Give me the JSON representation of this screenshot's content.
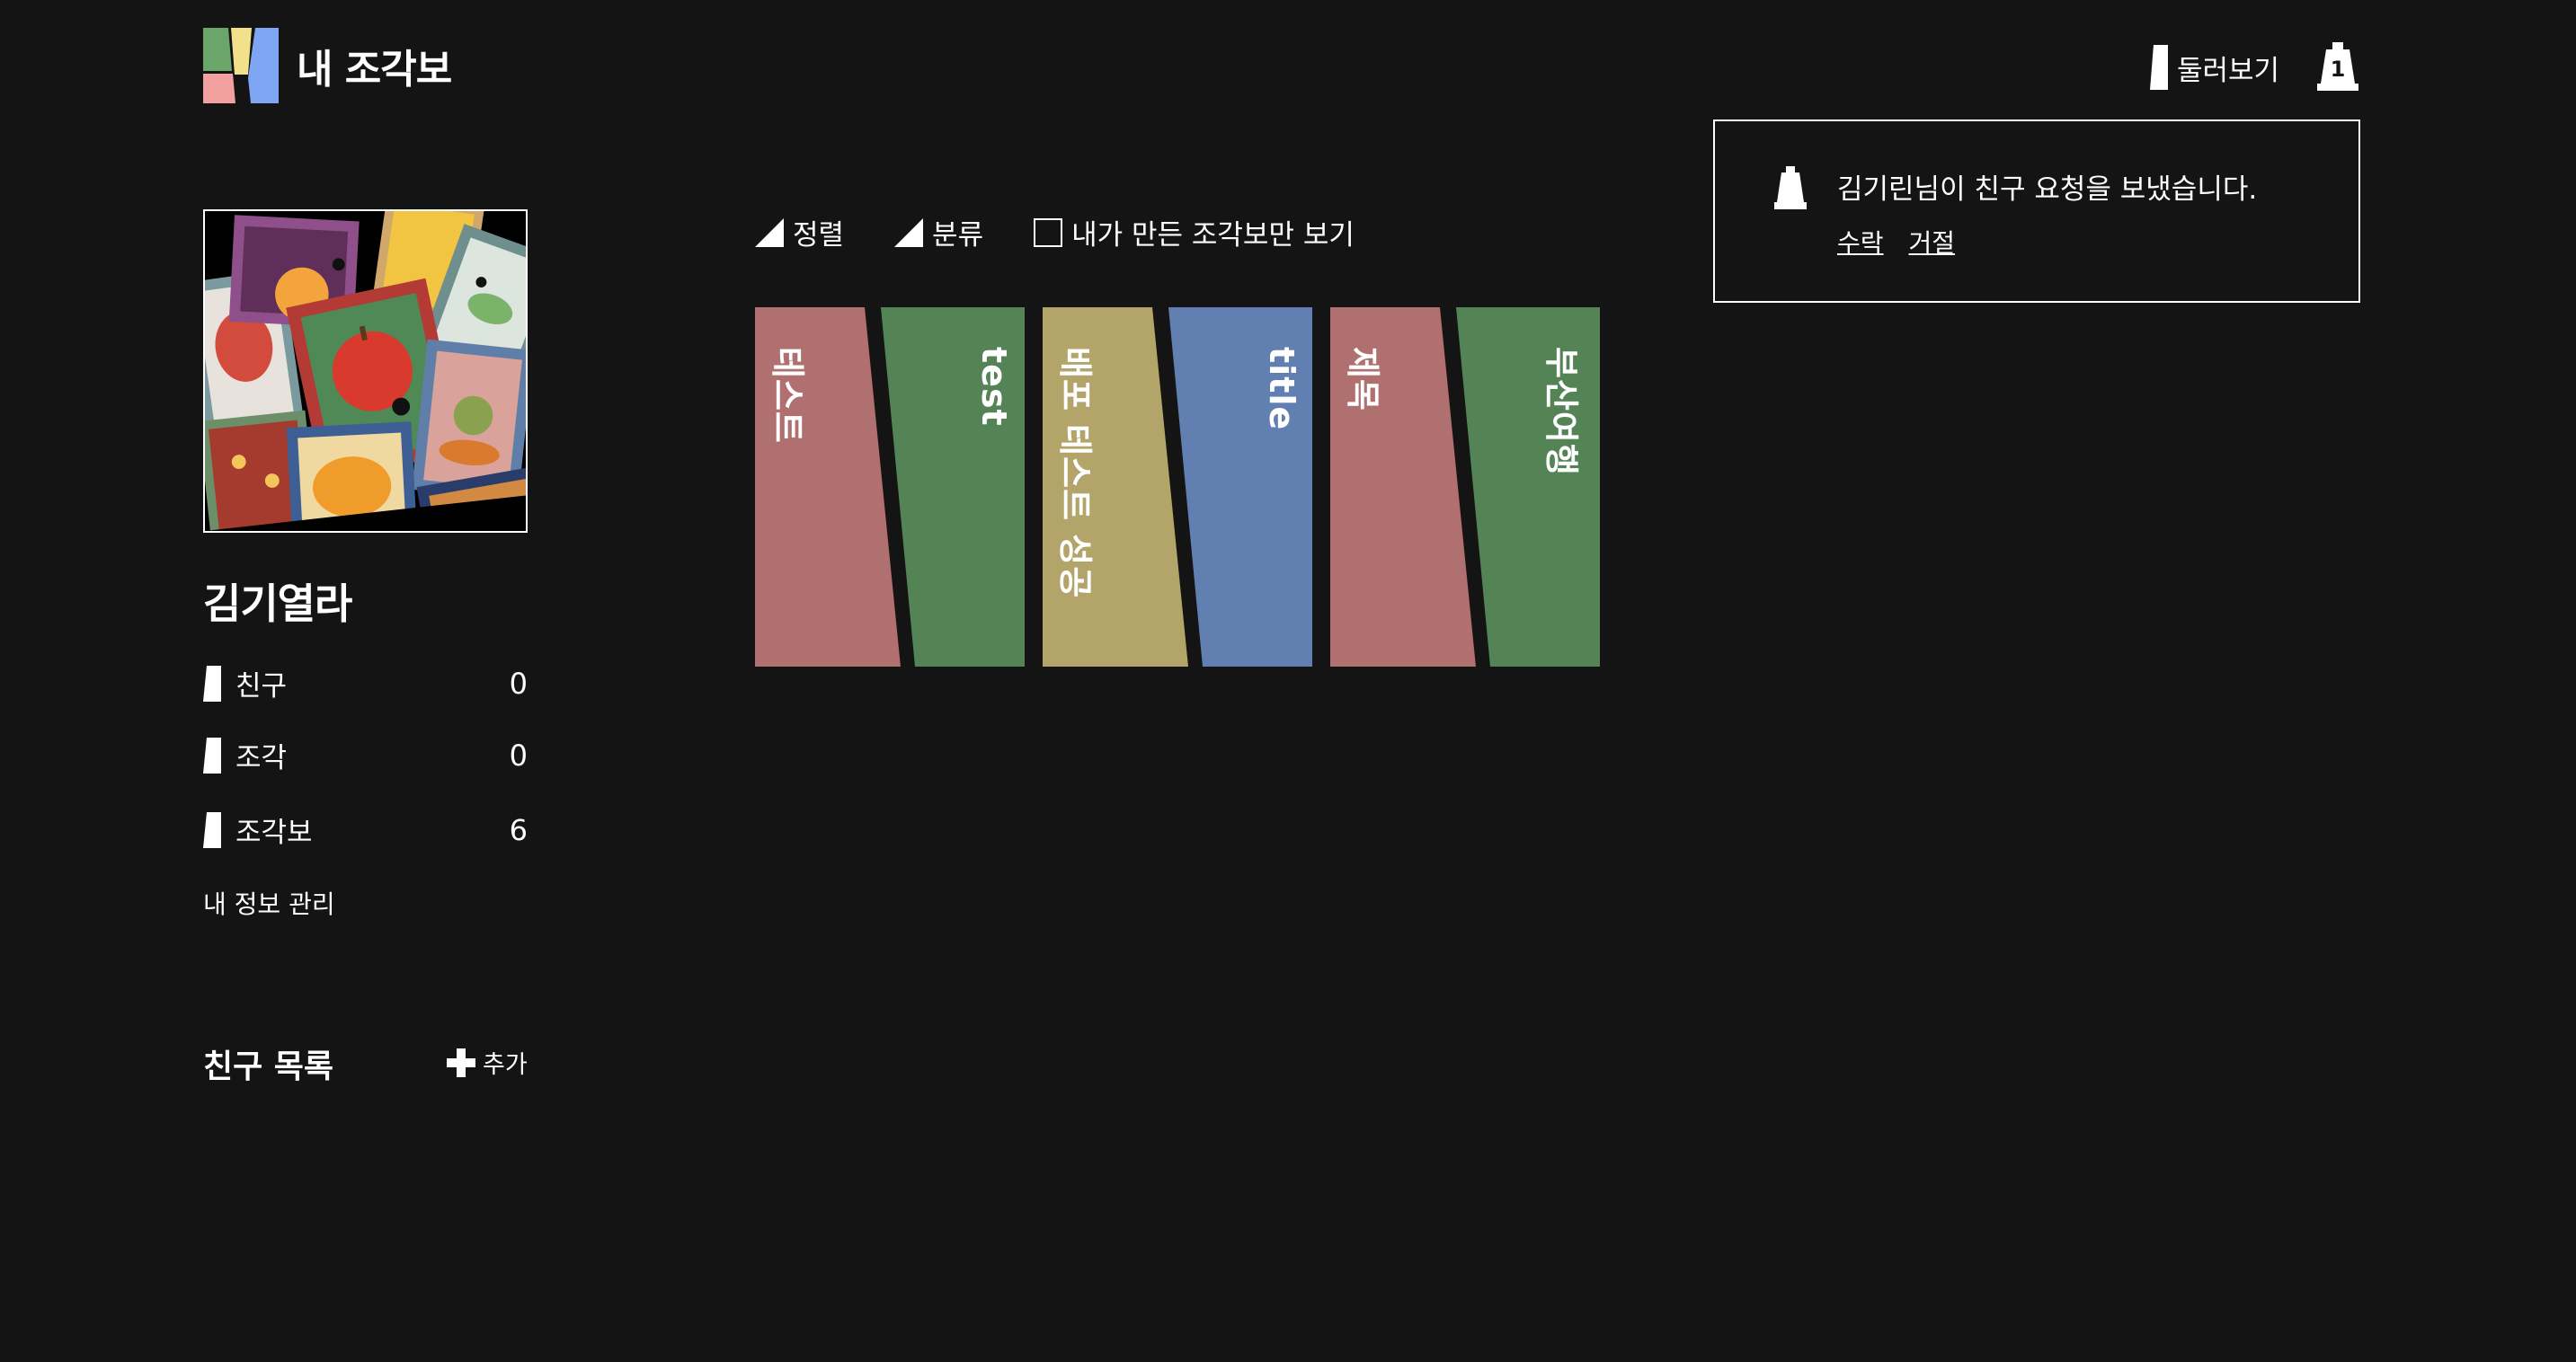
{
  "header": {
    "app_title": "내 조각보",
    "logo_icon": "patchwork-logo-icon",
    "browse_label": "둘러보기",
    "browse_icon": "bookmark-icon",
    "bell_icon": "bell-icon",
    "notification_count": "1"
  },
  "notification": {
    "icon": "bell-icon",
    "message": "김기린님이 친구 요청을 보냈습니다.",
    "accept_label": "수락",
    "reject_label": "거절"
  },
  "profile": {
    "name": "김기열라",
    "stats": [
      {
        "label": "친구",
        "value": "0"
      },
      {
        "label": "조각",
        "value": "0"
      },
      {
        "label": "조각보",
        "value": "6"
      }
    ],
    "manage_label": "내 정보 관리"
  },
  "friends": {
    "title": "친구 목록",
    "add_label": "추가"
  },
  "toolbar": {
    "sort_label": "정렬",
    "category_label": "분류",
    "mine_only_label": "내가 만든 조각보만 보기",
    "mine_only_checked": false
  },
  "books": [
    {
      "title": "테스트",
      "color": "#b07070"
    },
    {
      "title": "test",
      "color": "#548455"
    },
    {
      "title": "배포 테스트 성공",
      "color": "#b3a56a"
    },
    {
      "title": "title",
      "color": "#627fb1"
    },
    {
      "title": "제목",
      "color": "#b07070"
    },
    {
      "title": "부산여행",
      "color": "#548455"
    }
  ],
  "colors": {
    "background": "#141414",
    "text": "#ffffff",
    "logo_green": "#6aa56a",
    "logo_yellow": "#f2e08a",
    "logo_pink": "#f2a0a0",
    "logo_blue": "#7fa6f2"
  }
}
